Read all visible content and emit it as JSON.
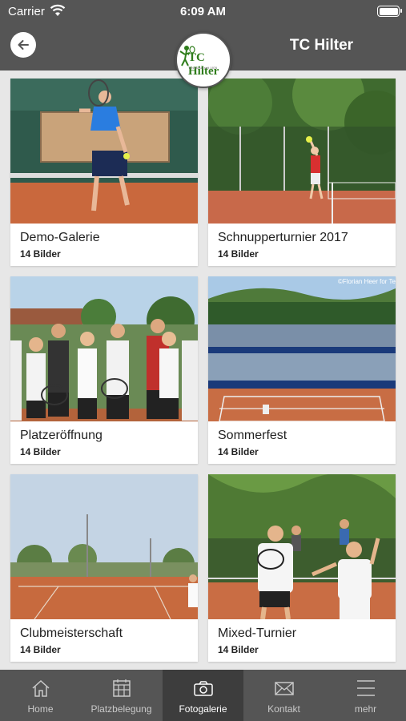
{
  "status_bar": {
    "carrier": "Carrier",
    "time": "6:09 AM"
  },
  "header": {
    "title": "TC Hilter",
    "logo_text": "TC Hilter",
    "logo_subtitle": "Tennisclub seit 1976"
  },
  "gallery": [
    {
      "title": "Demo-Galerie",
      "count": "14 Bilder"
    },
    {
      "title": "Schnupperturnier 2017",
      "count": "14 Bilder"
    },
    {
      "title": "Platzeröffnung",
      "count": "14 Bilder"
    },
    {
      "title": "Sommerfest",
      "count": "14 Bilder",
      "credit": "©Florian Heer for Te"
    },
    {
      "title": "Clubmeisterschaft",
      "count": "14 Bilder"
    },
    {
      "title": "Mixed-Turnier",
      "count": "14 Bilder"
    }
  ],
  "tabs": [
    {
      "label": "Home",
      "icon": "home-icon"
    },
    {
      "label": "Platzbelegung",
      "icon": "calendar-grid-icon"
    },
    {
      "label": "Fotogalerie",
      "icon": "camera-icon"
    },
    {
      "label": "Kontakt",
      "icon": "envelope-icon"
    },
    {
      "label": "mehr",
      "icon": "menu-icon"
    }
  ],
  "colors": {
    "bar": "#555555",
    "active_tab": "#3d3d3d",
    "background": "#e7e7e7",
    "clay": "#d97a4a"
  }
}
